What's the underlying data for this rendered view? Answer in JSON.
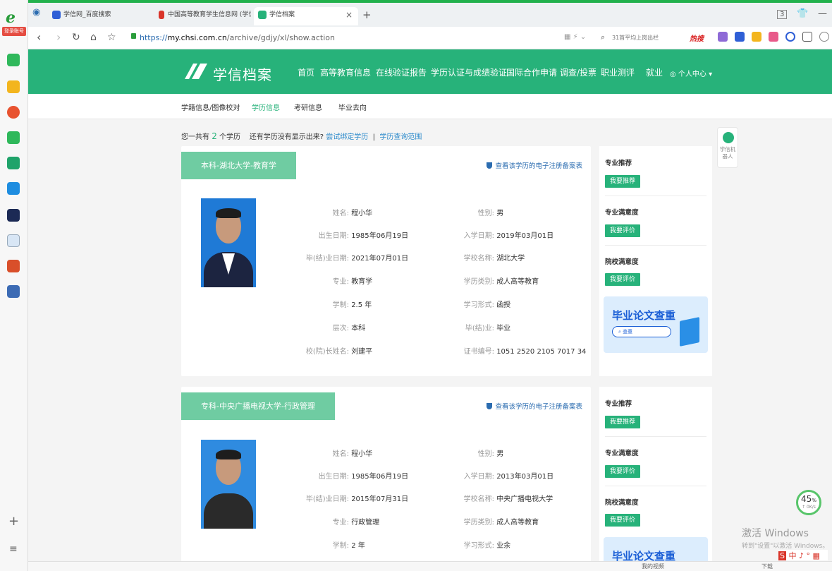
{
  "browser": {
    "login_badge": "登录账号",
    "tabs": [
      {
        "title": "学信网_百度搜索",
        "icon": "baidu-paw-icon"
      },
      {
        "title": "中国高等教育学生信息网 (学信",
        "icon": "chsi-flame-icon"
      },
      {
        "title": "学信档案",
        "icon": "chsi-logo-icon"
      }
    ],
    "new_tab": "+",
    "url_prefix": "https://",
    "url_host": "my.chsi.com.cn",
    "url_path": "/archive/gdjy/xl/show.action",
    "search_placeholder": "31首平均上岗出栏",
    "hot_label": "热搜",
    "tab_count": "3"
  },
  "site": {
    "brand": "学信档案",
    "nav": [
      "首页",
      "高等教育信息",
      "在线验证报告",
      "学历认证与成绩验证",
      "国际合作申请",
      "调查/投票",
      "职业测评",
      "就业",
      "个人中心"
    ],
    "nav_active": 1,
    "subnav": [
      "学籍信息/图像校对",
      "学历信息",
      "考研信息",
      "毕业去向"
    ],
    "subnav_active": 1,
    "count_prefix": "您一共有",
    "count_num": "2",
    "count_suffix": "个学历",
    "missing_q": "还有学历没有显示出来?",
    "try_bind": "尝试绑定学历",
    "sep": "|",
    "query_scope": "学历查询范围",
    "robot": "学信机器人",
    "accent": "#27b27a"
  },
  "records": [
    {
      "title": "本科-湖北大学-教育学",
      "verify": "查看该学历的电子注册备案表",
      "fields_left": [
        {
          "label": "姓名:",
          "value": "程小华"
        },
        {
          "label": "出生日期:",
          "value": "1985年06月19日"
        },
        {
          "label": "毕(结)业日期:",
          "value": "2021年07月01日"
        },
        {
          "label": "专业:",
          "value": "教育学"
        },
        {
          "label": "学制:",
          "value": "2.5 年"
        },
        {
          "label": "层次:",
          "value": "本科"
        },
        {
          "label": "校(院)长姓名:",
          "value": "刘建平"
        }
      ],
      "fields_right": [
        {
          "label": "性别:",
          "value": "男"
        },
        {
          "label": "入学日期:",
          "value": "2019年03月01日"
        },
        {
          "label": "学校名称:",
          "value": "湖北大学"
        },
        {
          "label": "学历类别:",
          "value": "成人高等教育"
        },
        {
          "label": "学习形式:",
          "value": "函授"
        },
        {
          "label": "毕(结)业:",
          "value": "毕业"
        },
        {
          "label": "证书编号:",
          "value": "1051 2520 2105 7017 34"
        }
      ]
    },
    {
      "title": "专科-中央广播电视大学-行政管理",
      "verify": "查看该学历的电子注册备案表",
      "fields_left": [
        {
          "label": "姓名:",
          "value": "程小华"
        },
        {
          "label": "出生日期:",
          "value": "1985年06月19日"
        },
        {
          "label": "毕(结)业日期:",
          "value": "2015年07月31日"
        },
        {
          "label": "专业:",
          "value": "行政管理"
        },
        {
          "label": "学制:",
          "value": "2 年"
        }
      ],
      "fields_right": [
        {
          "label": "性别:",
          "value": "男"
        },
        {
          "label": "入学日期:",
          "value": "2013年03月01日"
        },
        {
          "label": "学校名称:",
          "value": "中央广播电视大学"
        },
        {
          "label": "学历类别:",
          "value": "成人高等教育"
        },
        {
          "label": "学习形式:",
          "value": "业余"
        }
      ]
    }
  ],
  "sidebar": {
    "h1": "专业推荐",
    "b1": "我要推荐",
    "h2": "专业满意度",
    "b2": "我要评价",
    "h3": "院校满意度",
    "b3": "我要评价",
    "ad_title": "毕业论文查重",
    "ad_search": "查重"
  },
  "overlay": {
    "speed_pct": "45",
    "speed_unit": "%",
    "speed_rate": "↑ 0K/s",
    "watermark1": "激活 Windows",
    "watermark2": "转到\"设置\"以激活 Windows。",
    "ime": "中 ♪ ° ▦",
    "status_left": "我的视频",
    "status_right": "下载"
  }
}
